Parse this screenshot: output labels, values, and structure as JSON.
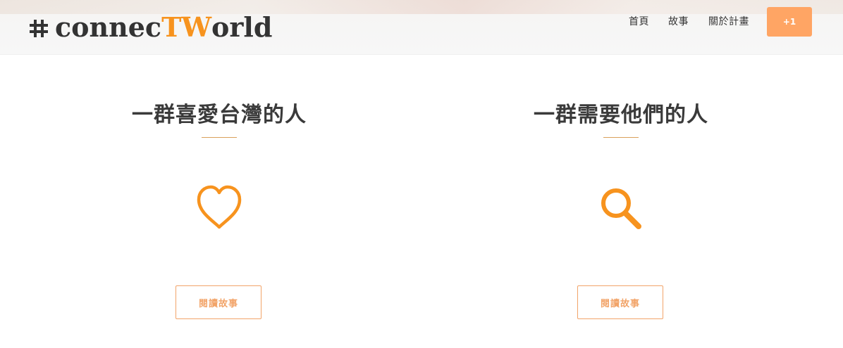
{
  "header": {
    "logo": {
      "prefix": "connec",
      "accent": "TW",
      "suffix": "orld"
    },
    "nav": {
      "home": "首頁",
      "story": "故事",
      "about": "關於計畫"
    },
    "plus_button": "+1"
  },
  "columns": [
    {
      "title": "一群喜愛台灣的人",
      "icon": "heart-icon",
      "button": "閱讀故事"
    },
    {
      "title": "一群需要他們的人",
      "icon": "search-icon",
      "button": "閱讀故事"
    }
  ],
  "colors": {
    "accent": "#f7931e",
    "button_fill": "#ffa564",
    "outline_button": "#f2a469",
    "title_text": "#3a3a3a"
  }
}
